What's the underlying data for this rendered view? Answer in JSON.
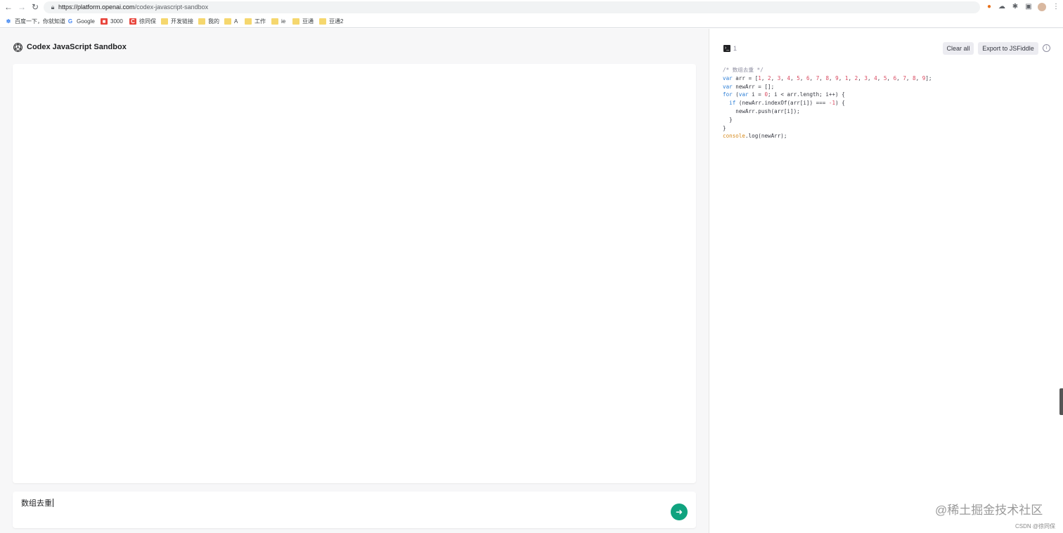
{
  "browser": {
    "url_host": "https://platform.openai.com",
    "url_path": "/codex-javascript-sandbox",
    "bookmarks": [
      {
        "label": "百度一下，你就知道",
        "icon": "baidu-icon",
        "color": "#2e7bf0"
      },
      {
        "label": "Google",
        "icon": "google-icon",
        "color": "#4285f4"
      },
      {
        "label": "3000",
        "icon": "app-icon",
        "color": "#e8453c"
      },
      {
        "label": "徐同保",
        "icon": "csdn-icon",
        "color": "#e8453c"
      },
      {
        "label": "开发链接",
        "icon": "folder-icon",
        "color": "#f5d76e"
      },
      {
        "label": "我的",
        "icon": "folder-icon",
        "color": "#f5d76e"
      },
      {
        "label": "A",
        "icon": "folder-icon",
        "color": "#f5d76e"
      },
      {
        "label": "工作",
        "icon": "folder-icon",
        "color": "#f5d76e"
      },
      {
        "label": "ie",
        "icon": "folder-icon",
        "color": "#f5d76e"
      },
      {
        "label": "豆通",
        "icon": "folder-icon",
        "color": "#f5d76e"
      },
      {
        "label": "豆通2",
        "icon": "folder-icon",
        "color": "#f5d76e"
      }
    ]
  },
  "app": {
    "title": "Codex JavaScript Sandbox",
    "accent": "#10a37f"
  },
  "prompt": {
    "value": "数组去重"
  },
  "right_panel": {
    "count": "1",
    "clear_label": "Clear all",
    "export_label": "Export to JSFiddle"
  },
  "code_lines": [
    [
      {
        "t": "/* 数组去重 */",
        "c": "cmt"
      }
    ],
    [
      {
        "t": "var",
        "c": "kw"
      },
      {
        "t": " arr = [",
        "c": "pl"
      },
      {
        "t": "1",
        "c": "num"
      },
      {
        "t": ", ",
        "c": "pl"
      },
      {
        "t": "2",
        "c": "num"
      },
      {
        "t": ", ",
        "c": "pl"
      },
      {
        "t": "3",
        "c": "num"
      },
      {
        "t": ", ",
        "c": "pl"
      },
      {
        "t": "4",
        "c": "num"
      },
      {
        "t": ", ",
        "c": "pl"
      },
      {
        "t": "5",
        "c": "num"
      },
      {
        "t": ", ",
        "c": "pl"
      },
      {
        "t": "6",
        "c": "num"
      },
      {
        "t": ", ",
        "c": "pl"
      },
      {
        "t": "7",
        "c": "num"
      },
      {
        "t": ", ",
        "c": "pl"
      },
      {
        "t": "8",
        "c": "num"
      },
      {
        "t": ", ",
        "c": "pl"
      },
      {
        "t": "9",
        "c": "num"
      },
      {
        "t": ", ",
        "c": "pl"
      },
      {
        "t": "1",
        "c": "num"
      },
      {
        "t": ", ",
        "c": "pl"
      },
      {
        "t": "2",
        "c": "num"
      },
      {
        "t": ", ",
        "c": "pl"
      },
      {
        "t": "3",
        "c": "num"
      },
      {
        "t": ", ",
        "c": "pl"
      },
      {
        "t": "4",
        "c": "num"
      },
      {
        "t": ", ",
        "c": "pl"
      },
      {
        "t": "5",
        "c": "num"
      },
      {
        "t": ", ",
        "c": "pl"
      },
      {
        "t": "6",
        "c": "num"
      },
      {
        "t": ", ",
        "c": "pl"
      },
      {
        "t": "7",
        "c": "num"
      },
      {
        "t": ", ",
        "c": "pl"
      },
      {
        "t": "8",
        "c": "num"
      },
      {
        "t": ", ",
        "c": "pl"
      },
      {
        "t": "9",
        "c": "num"
      },
      {
        "t": "];",
        "c": "pl"
      }
    ],
    [
      {
        "t": "var",
        "c": "kw"
      },
      {
        "t": " newArr = [];",
        "c": "pl"
      }
    ],
    [
      {
        "t": "for",
        "c": "kw"
      },
      {
        "t": " (",
        "c": "pl"
      },
      {
        "t": "var",
        "c": "kw"
      },
      {
        "t": " i = ",
        "c": "pl"
      },
      {
        "t": "0",
        "c": "num"
      },
      {
        "t": "; i < arr.length; i++) {",
        "c": "pl"
      }
    ],
    [
      {
        "t": "  ",
        "c": "pl"
      },
      {
        "t": "if",
        "c": "kw"
      },
      {
        "t": " (newArr.indexOf(arr[i]) === ",
        "c": "pl"
      },
      {
        "t": "-1",
        "c": "num"
      },
      {
        "t": ") {",
        "c": "pl"
      }
    ],
    [
      {
        "t": "    newArr.push(arr[i]);",
        "c": "pl"
      }
    ],
    [
      {
        "t": "  }",
        "c": "pl"
      }
    ],
    [
      {
        "t": "}",
        "c": "pl"
      }
    ],
    [
      {
        "t": "console",
        "c": "fn"
      },
      {
        "t": ".log(newArr);",
        "c": "pl"
      }
    ]
  ],
  "watermark": {
    "text": "@稀土掘金技术社区",
    "credit": "CSDN @徐同保"
  }
}
